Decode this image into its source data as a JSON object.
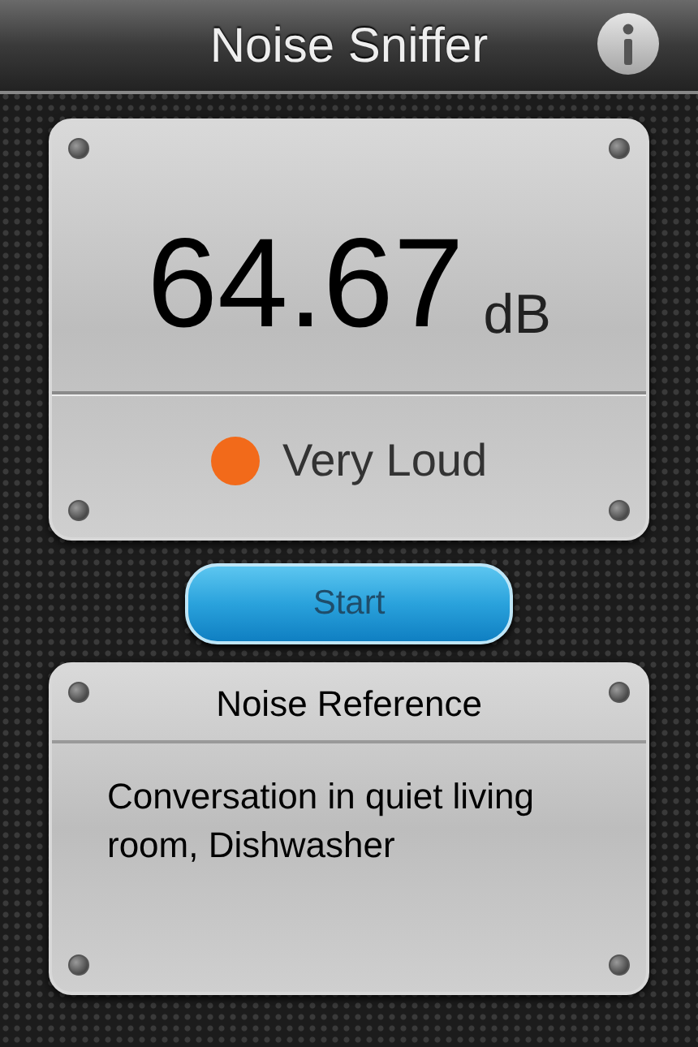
{
  "header": {
    "title": "Noise Sniffer"
  },
  "meter": {
    "reading": "64.67",
    "unit": "dB",
    "status": {
      "label": "Very Loud",
      "color": "#f26a1a"
    }
  },
  "start_button": {
    "label": "Start"
  },
  "reference": {
    "title": "Noise Reference",
    "text": "Conversation in quiet living room, Dishwasher"
  }
}
